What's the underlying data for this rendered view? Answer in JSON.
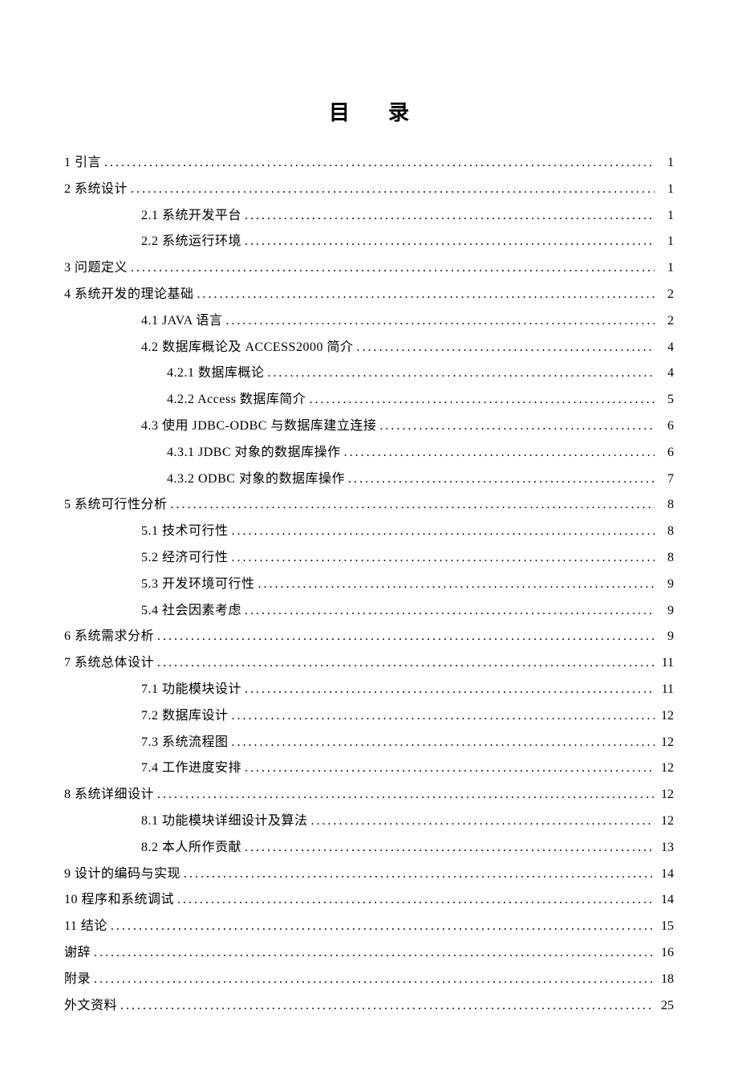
{
  "title": "目录",
  "toc": [
    {
      "level": 0,
      "label": "1 引言",
      "page": "1"
    },
    {
      "level": 0,
      "label": "2 系统设计",
      "page": "1"
    },
    {
      "level": 1,
      "label": "2.1 系统开发平台",
      "page": "1"
    },
    {
      "level": 1,
      "label": "2.2 系统运行环境",
      "page": "1"
    },
    {
      "level": 0,
      "label": "3 问题定义",
      "page": "1"
    },
    {
      "level": 0,
      "label": "4 系统开发的理论基础",
      "page": "2"
    },
    {
      "level": 1,
      "label": "4.1 JAVA 语言",
      "page": "2"
    },
    {
      "level": 1,
      "label": "4.2 数据库概论及 ACCESS2000 简介",
      "page": "4"
    },
    {
      "level": 2,
      "label": "4.2.1 数据库概论",
      "page": "4"
    },
    {
      "level": 2,
      "label": "4.2.2 Access 数据库简介",
      "page": "5"
    },
    {
      "level": 1,
      "label": "4.3 使用 JDBC-ODBC 与数据库建立连接",
      "page": "6"
    },
    {
      "level": 2,
      "label": "4.3.1 JDBC 对象的数据库操作",
      "page": "6"
    },
    {
      "level": 2,
      "label": "4.3.2 ODBC 对象的数据库操作",
      "page": "7"
    },
    {
      "level": 0,
      "label": "5 系统可行性分析",
      "page": "8"
    },
    {
      "level": 1,
      "label": "5.1 技术可行性",
      "page": "8"
    },
    {
      "level": 1,
      "label": "5.2 经济可行性",
      "page": "8"
    },
    {
      "level": 1,
      "label": "5.3 开发环境可行性",
      "page": "9"
    },
    {
      "level": 1,
      "label": "5.4 社会因素考虑",
      "page": "9"
    },
    {
      "level": 0,
      "label": "6 系统需求分析",
      "page": "9"
    },
    {
      "level": 0,
      "label": "7 系统总体设计",
      "page": "11"
    },
    {
      "level": 1,
      "label": "7.1 功能模块设计",
      "page": "11"
    },
    {
      "level": 1,
      "label": "7.2 数据库设计",
      "page": "12"
    },
    {
      "level": 1,
      "label": "7.3 系统流程图",
      "page": "12"
    },
    {
      "level": 1,
      "label": "7.4 工作进度安排",
      "page": "12"
    },
    {
      "level": 0,
      "label": "8 系统详细设计",
      "page": "12"
    },
    {
      "level": 1,
      "label": "8.1 功能模块详细设计及算法",
      "page": "12"
    },
    {
      "level": 1,
      "label": "8.2 本人所作贡献",
      "page": "13"
    },
    {
      "level": 0,
      "label": "9 设计的编码与实现",
      "page": "14"
    },
    {
      "level": 0,
      "label": "10 程序和系统调试",
      "page": "14"
    },
    {
      "level": 0,
      "label": "11 结论",
      "page": "15"
    },
    {
      "level": 0,
      "label": "谢辞",
      "page": "16"
    },
    {
      "level": 0,
      "label": "附录",
      "page": "18"
    },
    {
      "level": 0,
      "label": "外文资料",
      "page": "25"
    }
  ]
}
